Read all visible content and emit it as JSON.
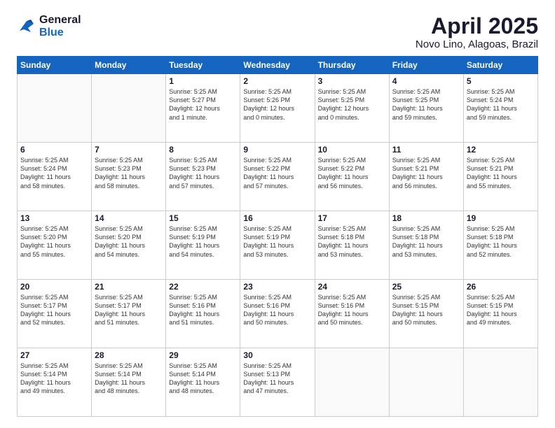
{
  "logo": {
    "line1": "General",
    "line2": "Blue"
  },
  "title": "April 2025",
  "subtitle": "Novo Lino, Alagoas, Brazil",
  "days_of_week": [
    "Sunday",
    "Monday",
    "Tuesday",
    "Wednesday",
    "Thursday",
    "Friday",
    "Saturday"
  ],
  "weeks": [
    [
      {
        "num": "",
        "info": ""
      },
      {
        "num": "",
        "info": ""
      },
      {
        "num": "1",
        "info": "Sunrise: 5:25 AM\nSunset: 5:27 PM\nDaylight: 12 hours\nand 1 minute."
      },
      {
        "num": "2",
        "info": "Sunrise: 5:25 AM\nSunset: 5:26 PM\nDaylight: 12 hours\nand 0 minutes."
      },
      {
        "num": "3",
        "info": "Sunrise: 5:25 AM\nSunset: 5:25 PM\nDaylight: 12 hours\nand 0 minutes."
      },
      {
        "num": "4",
        "info": "Sunrise: 5:25 AM\nSunset: 5:25 PM\nDaylight: 11 hours\nand 59 minutes."
      },
      {
        "num": "5",
        "info": "Sunrise: 5:25 AM\nSunset: 5:24 PM\nDaylight: 11 hours\nand 59 minutes."
      }
    ],
    [
      {
        "num": "6",
        "info": "Sunrise: 5:25 AM\nSunset: 5:24 PM\nDaylight: 11 hours\nand 58 minutes."
      },
      {
        "num": "7",
        "info": "Sunrise: 5:25 AM\nSunset: 5:23 PM\nDaylight: 11 hours\nand 58 minutes."
      },
      {
        "num": "8",
        "info": "Sunrise: 5:25 AM\nSunset: 5:23 PM\nDaylight: 11 hours\nand 57 minutes."
      },
      {
        "num": "9",
        "info": "Sunrise: 5:25 AM\nSunset: 5:22 PM\nDaylight: 11 hours\nand 57 minutes."
      },
      {
        "num": "10",
        "info": "Sunrise: 5:25 AM\nSunset: 5:22 PM\nDaylight: 11 hours\nand 56 minutes."
      },
      {
        "num": "11",
        "info": "Sunrise: 5:25 AM\nSunset: 5:21 PM\nDaylight: 11 hours\nand 56 minutes."
      },
      {
        "num": "12",
        "info": "Sunrise: 5:25 AM\nSunset: 5:21 PM\nDaylight: 11 hours\nand 55 minutes."
      }
    ],
    [
      {
        "num": "13",
        "info": "Sunrise: 5:25 AM\nSunset: 5:20 PM\nDaylight: 11 hours\nand 55 minutes."
      },
      {
        "num": "14",
        "info": "Sunrise: 5:25 AM\nSunset: 5:20 PM\nDaylight: 11 hours\nand 54 minutes."
      },
      {
        "num": "15",
        "info": "Sunrise: 5:25 AM\nSunset: 5:19 PM\nDaylight: 11 hours\nand 54 minutes."
      },
      {
        "num": "16",
        "info": "Sunrise: 5:25 AM\nSunset: 5:19 PM\nDaylight: 11 hours\nand 53 minutes."
      },
      {
        "num": "17",
        "info": "Sunrise: 5:25 AM\nSunset: 5:18 PM\nDaylight: 11 hours\nand 53 minutes."
      },
      {
        "num": "18",
        "info": "Sunrise: 5:25 AM\nSunset: 5:18 PM\nDaylight: 11 hours\nand 53 minutes."
      },
      {
        "num": "19",
        "info": "Sunrise: 5:25 AM\nSunset: 5:18 PM\nDaylight: 11 hours\nand 52 minutes."
      }
    ],
    [
      {
        "num": "20",
        "info": "Sunrise: 5:25 AM\nSunset: 5:17 PM\nDaylight: 11 hours\nand 52 minutes."
      },
      {
        "num": "21",
        "info": "Sunrise: 5:25 AM\nSunset: 5:17 PM\nDaylight: 11 hours\nand 51 minutes."
      },
      {
        "num": "22",
        "info": "Sunrise: 5:25 AM\nSunset: 5:16 PM\nDaylight: 11 hours\nand 51 minutes."
      },
      {
        "num": "23",
        "info": "Sunrise: 5:25 AM\nSunset: 5:16 PM\nDaylight: 11 hours\nand 50 minutes."
      },
      {
        "num": "24",
        "info": "Sunrise: 5:25 AM\nSunset: 5:16 PM\nDaylight: 11 hours\nand 50 minutes."
      },
      {
        "num": "25",
        "info": "Sunrise: 5:25 AM\nSunset: 5:15 PM\nDaylight: 11 hours\nand 50 minutes."
      },
      {
        "num": "26",
        "info": "Sunrise: 5:25 AM\nSunset: 5:15 PM\nDaylight: 11 hours\nand 49 minutes."
      }
    ],
    [
      {
        "num": "27",
        "info": "Sunrise: 5:25 AM\nSunset: 5:14 PM\nDaylight: 11 hours\nand 49 minutes."
      },
      {
        "num": "28",
        "info": "Sunrise: 5:25 AM\nSunset: 5:14 PM\nDaylight: 11 hours\nand 48 minutes."
      },
      {
        "num": "29",
        "info": "Sunrise: 5:25 AM\nSunset: 5:14 PM\nDaylight: 11 hours\nand 48 minutes."
      },
      {
        "num": "30",
        "info": "Sunrise: 5:25 AM\nSunset: 5:13 PM\nDaylight: 11 hours\nand 47 minutes."
      },
      {
        "num": "",
        "info": ""
      },
      {
        "num": "",
        "info": ""
      },
      {
        "num": "",
        "info": ""
      }
    ]
  ]
}
